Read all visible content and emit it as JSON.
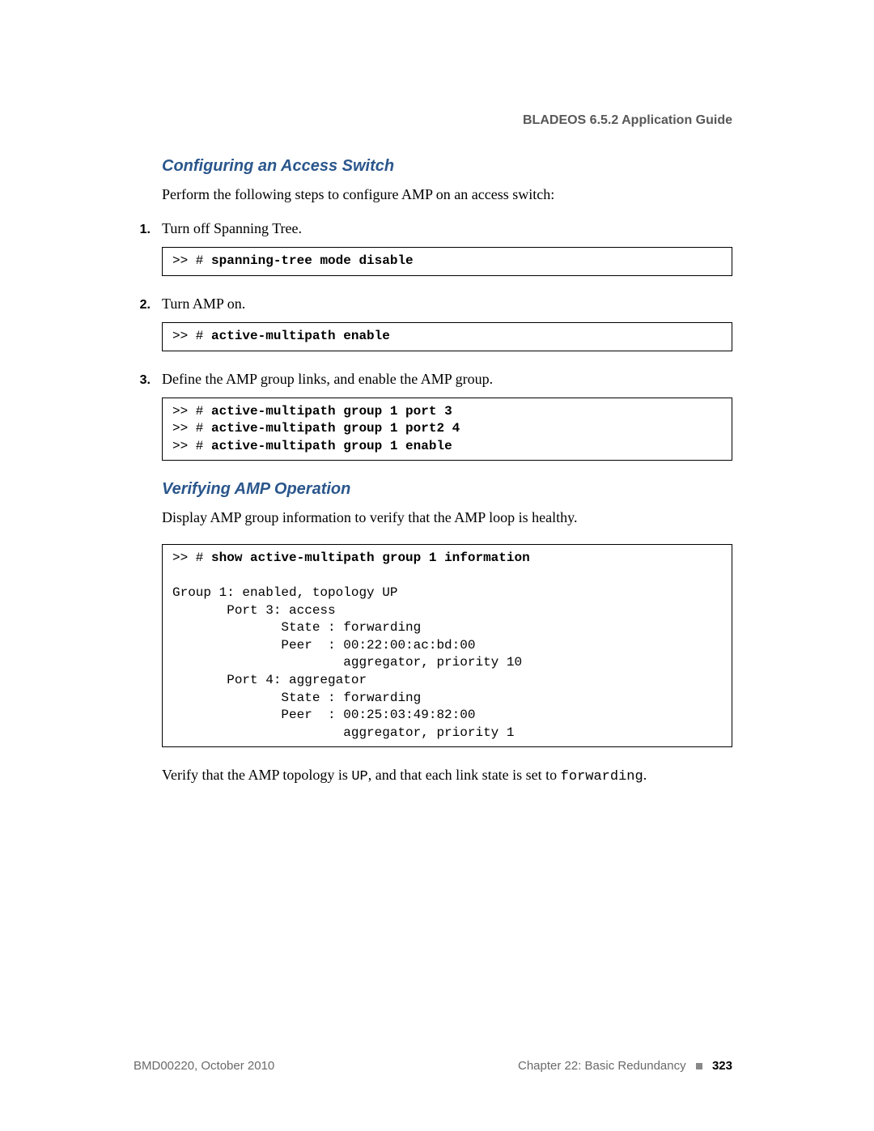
{
  "header": {
    "title": "BLADEOS 6.5.2 Application Guide"
  },
  "sections": {
    "s1": {
      "heading": "Configuring an Access Switch",
      "intro": "Perform the following steps to configure AMP on an access switch:",
      "steps": {
        "n1": "1.",
        "t1": "Turn off Spanning Tree.",
        "c1_prefix": ">> # ",
        "c1_bold": "spanning-tree mode disable",
        "n2": "2.",
        "t2": "Turn AMP on.",
        "c2_prefix": ">> # ",
        "c2_bold": "active-multipath enable",
        "n3": "3.",
        "t3": "Define the AMP group links, and enable the AMP group.",
        "c3_l1_prefix": ">> # ",
        "c3_l1_bold": "active-multipath group 1 port 3",
        "c3_l2_prefix": ">> # ",
        "c3_l2_bold": "active-multipath group 1 port2 4",
        "c3_l3_prefix": ">> # ",
        "c3_l3_bold": "active-multipath group 1 enable"
      }
    },
    "s2": {
      "heading": "Verifying AMP Operation",
      "intro": "Display AMP group information to verify that the AMP loop is healthy.",
      "code_prefix": ">> # ",
      "code_bold": "show active-multipath group 1 information",
      "code_output": "\n\nGroup 1: enabled, topology UP\n       Port 3: access\n              State : forwarding\n              Peer  : 00:22:00:ac:bd:00\n                      aggregator, priority 10\n       Port 4: aggregator\n              State : forwarding\n              Peer  : 00:25:03:49:82:00\n                      aggregator, priority 1",
      "verify_pre": "Verify that the AMP topology is ",
      "verify_up": "UP",
      "verify_mid": ", and that each link state is set to ",
      "verify_fwd": "forwarding",
      "verify_post": "."
    }
  },
  "footer": {
    "left": "BMD00220, October 2010",
    "chapter": "Chapter 22: Basic Redundancy",
    "page": "323"
  }
}
